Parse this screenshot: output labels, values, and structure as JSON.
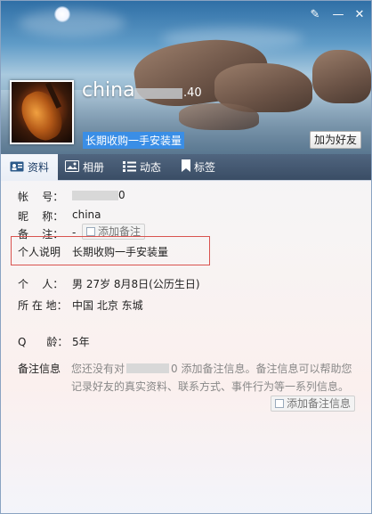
{
  "window": {
    "controls": {
      "skin": "✎",
      "minimize": "—",
      "close": "✕"
    }
  },
  "header": {
    "nickname": "china",
    "qq_number_tail": ".40",
    "signature": "长期收购一手安装量",
    "add_friend_label": "加为好友"
  },
  "tabs": [
    {
      "label": "资料",
      "icon": "profile-card-icon",
      "active": true
    },
    {
      "label": "相册",
      "icon": "photo-album-icon",
      "active": false
    },
    {
      "label": "动态",
      "icon": "feed-list-icon",
      "active": false
    },
    {
      "label": "标签",
      "icon": "bookmark-icon",
      "active": false
    }
  ],
  "profile": {
    "account_label": "帐    号：",
    "account_tail": "0",
    "nickname_label": "昵    称：",
    "nickname_value": "china",
    "remark_label": "备    注：",
    "remark_value": "-",
    "add_remark_label": "添加备注",
    "personal_desc_label": "个人说明",
    "personal_desc_value": "长期收购一手安装量",
    "person_label": "个    人：",
    "person_value": "男    27岁    8月8日(公历生日)",
    "location_label": "所 在 地：",
    "location_value": "中国 北京 东城",
    "qage_label": "Q      龄：",
    "qage_value": "5年",
    "remark_info_label": "备注信息",
    "remark_info_prefix": "您还没有对",
    "remark_info_tail": "0 添加备注信息。备注信息可以帮助您记录好友的真实资料、联系方式、事件行为等一系列信息。",
    "add_remark_info_label": "添加备注信息"
  },
  "colors": {
    "signature_bg": "#3a8ee6",
    "highlight_border": "#d9534f",
    "tabbar_bg": "#3f526a"
  }
}
